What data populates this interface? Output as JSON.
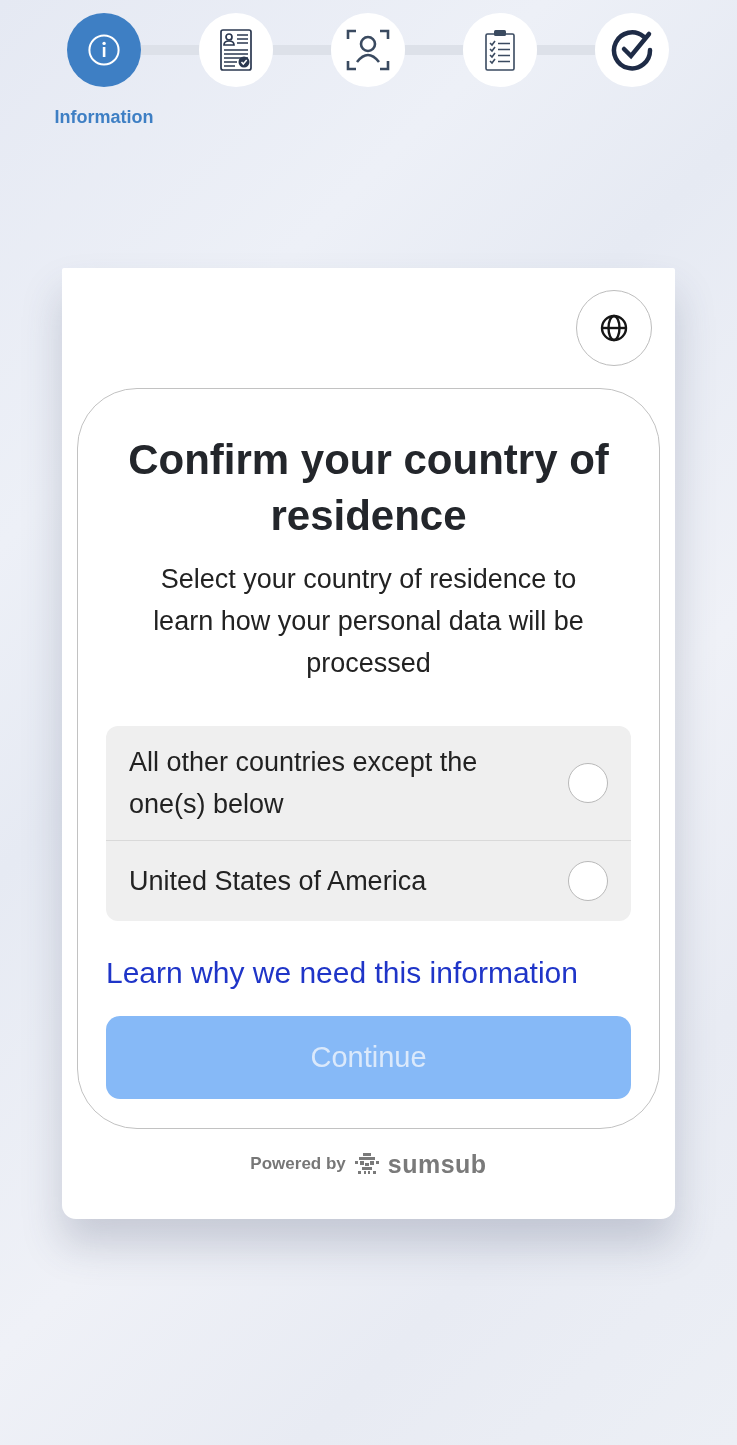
{
  "stepper": {
    "steps": [
      {
        "kind": "info",
        "selected": true,
        "label": "Information"
      },
      {
        "kind": "document",
        "selected": false
      },
      {
        "kind": "face-scan",
        "selected": false
      },
      {
        "kind": "checklist",
        "selected": false
      },
      {
        "kind": "done",
        "selected": false
      }
    ]
  },
  "title": "Confirm your country of residence",
  "subtitle": "Select your country of residence to learn how your personal data will be processed",
  "options": [
    {
      "label": "All other countries except the one(s) below",
      "selected": false
    },
    {
      "label": "United States of America",
      "selected": false
    }
  ],
  "link": "Learn why we need this information",
  "continue_button": {
    "label": "Continue",
    "disabled": true
  },
  "footer": {
    "powered_by": "Powered by",
    "brand": "sumsub"
  }
}
